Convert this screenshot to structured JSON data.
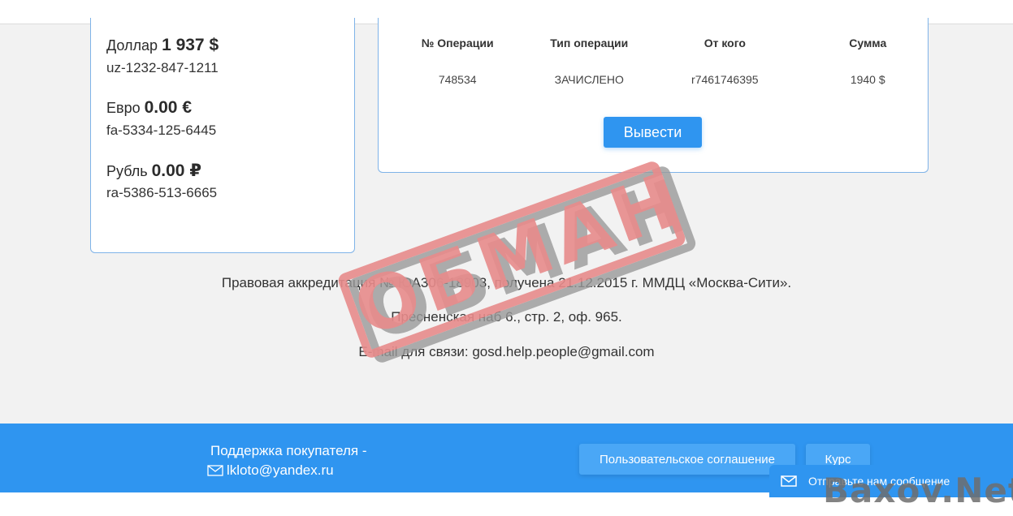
{
  "balances": [
    {
      "currency": "Доллар",
      "amount": "1 937 $",
      "account": "uz-1232-847-1211"
    },
    {
      "currency": "Евро",
      "amount": "0.00 €",
      "account": "fa-5334-125-6445"
    },
    {
      "currency": "Рубль",
      "amount": "0.00 ₽",
      "account": "ra-5386-513-6665"
    }
  ],
  "operations": {
    "headers": [
      "№ Операции",
      "Тип операции",
      "От кого",
      "Сумма"
    ],
    "rows": [
      [
        "748534",
        "ЗАЧИСЛЕНО",
        "r7461746395",
        "1940 $"
      ]
    ],
    "withdraw_label": "Вывести"
  },
  "info": {
    "accreditation": "Правовая аккредитация № ЮА306-18903, получена 21.12.2015 г. ММДЦ «Москва-Сити».",
    "address": "Пресненская наб 6., стр. 2, оф. 965.",
    "email": "E-mail для связи: gosd.help.people@gmail.com"
  },
  "stamp": "ОБМАН",
  "footer": {
    "support_title": "Поддержка покупателя -",
    "support_email": "lkloto@yandex.ru",
    "agreement_label": "Пользовательское соглашение",
    "course_label": "Курс"
  },
  "chat": {
    "label": "Отправьте нам сообщение",
    "icon": "envelope-icon"
  },
  "watermark": "Baxov.Net",
  "colors": {
    "accent": "#2f95f0",
    "stamp": "#e88b8b",
    "border": "#7fb3e8"
  }
}
